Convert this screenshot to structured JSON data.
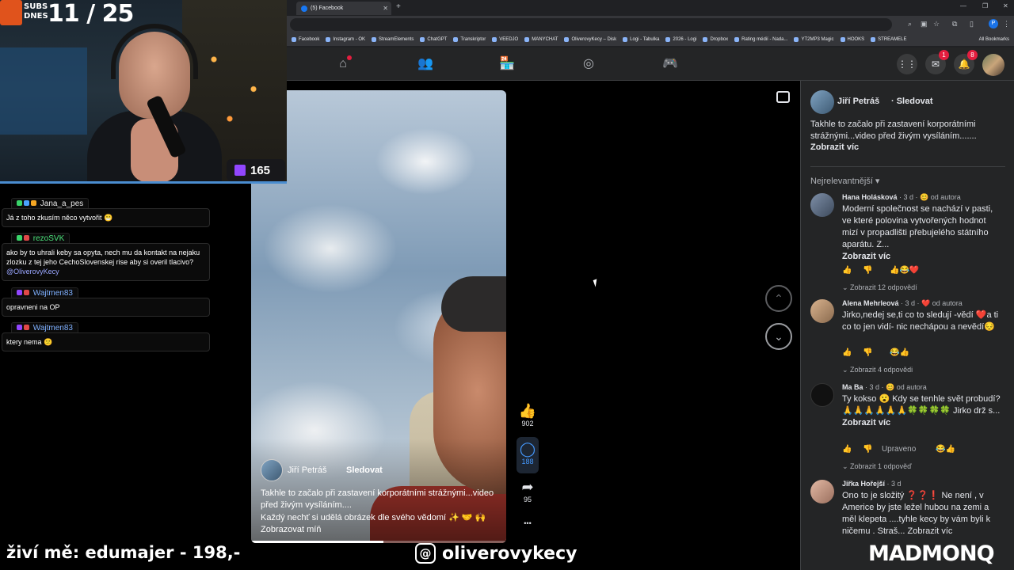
{
  "browser": {
    "tabs": [
      {
        "title": "(5) Facebook"
      }
    ],
    "bookmarks": [
      "Facebook",
      "Instagram - OK",
      "StreamElements",
      "ChatGPT",
      "Transkriptor",
      "VEEDJO",
      "MANYCHAT",
      "OliverovyKecy – Disk",
      "Logi - Tabulka",
      "2026 - Logi",
      "Dropbox",
      "Rating médií - Nada...",
      "YT2MP3 Magic",
      "HOOKS",
      "STREAMELE"
    ],
    "all_bookmarks": "All Bookmarks",
    "profile_initial": "P"
  },
  "fb_nav": {
    "messenger_badge": "1",
    "notifications_badge": "8"
  },
  "reel": {
    "author": "Jiří Petráš",
    "follow": "Sledovat",
    "caption_line1": "Takhle to začalo při zastavení korporátními strážnými...video",
    "caption_line2": "před živým vysíláním....",
    "caption_line3": "Každý nechť si udělá obrázek dle svého vědomí ✨ 🤝 🙌",
    "caption_more": "Zobrazovat míň",
    "likes": "902",
    "comments": "188",
    "shares": "95",
    "more": "•••",
    "progress": 0.52
  },
  "panel": {
    "author": "Jiří Petráš",
    "follow": "· Sledovat",
    "text": "Takhle to začalo při zastavení korporátními strážnými...video před živým vysíláním.......",
    "more": "Zobrazit víc",
    "sort": "Nejrelevantnější ▾",
    "comments": [
      {
        "name": "Hana Holásková",
        "time": "· 3 d · 😊 od autora",
        "body": "Moderní společnost se nachází v pasti, ve které polovina vytvořených hodnot mizí v propadlišti přebujelého státního aparátu. Z...",
        "more": "Zobrazit víc",
        "reactions": "👍😂❤️",
        "replies": "⌄ Zobrazit 12 odpovědí"
      },
      {
        "name": "Alena Mehrleová",
        "time": "· 3 d · ❤️ od autora",
        "body": "Jirko,nedej se,ti co to sledují -vědí ❤️a ti co to jen vidí- nic nechápou a nevědí😔",
        "more": "",
        "reactions": "😂👍",
        "replies": "⌄ Zobrazit 4 odpovědi"
      },
      {
        "name": "Ma Ba",
        "time": "· 3 d · 😊 od autora",
        "body": "Ty kokso 😮 Kdy se tenhle svět probudí? 🙏🙏🙏🙏🙏🙏🍀🍀🍀🍀 Jirko drž s...",
        "more": "Zobrazit víc",
        "edited": "Upraveno",
        "reactions": "😂👍",
        "replies": "⌄ Zobrazit 1 odpověď"
      },
      {
        "name": "Jiřka Hořejší",
        "time": "· 3 d",
        "body": "Ono to je složitý ❓❓❗ Ne není , v Americe by jste ležel hubou na zemi a měl klepeta ....tyhle kecy by vám byli k ničemu . Straš... Zobrazit víc",
        "more": "",
        "reactions": "",
        "replies": ""
      }
    ]
  },
  "stream": {
    "subs_label_1": "SUBS",
    "subs_label_2": "DNES",
    "subs_count": "11 / 25",
    "viewers": "165",
    "chat": [
      {
        "name": "Jana_a_pes",
        "name_color": "#e8e8e8",
        "msg": "Já z toho zkusím něco vytvořit 😁"
      },
      {
        "name": "rezoSVK",
        "name_color": "#4be37b",
        "msg": "ako by to uhrali keby sa opyta, nech mu da kontakt na nejaku zlozku z tej jeho CechoSlovenskej rise aby si overil tlacivo?",
        "mention": "@OliverovyKecy"
      },
      {
        "name": "Wajtmen83",
        "name_color": "#7fb0ff",
        "msg": "opravneni na OP"
      },
      {
        "name": "Wajtmen83",
        "name_color": "#7fb0ff",
        "msg": "ktery nema 😕"
      }
    ],
    "donor": "živí mě: edumajer - 198,-",
    "threads_handle": "oliverovykecy",
    "sponsor": "MADMONQ"
  }
}
